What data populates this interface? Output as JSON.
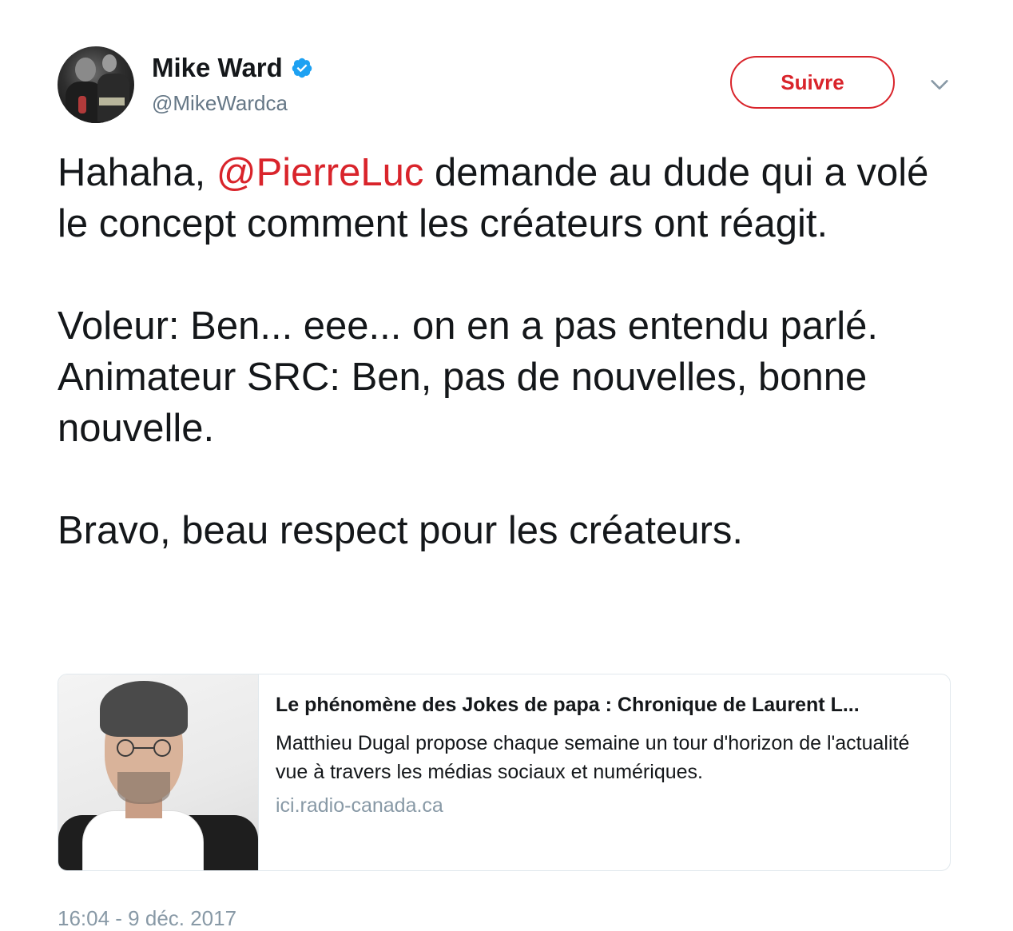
{
  "author": {
    "name": "Mike Ward",
    "handle": "@MikeWardca",
    "verified": true
  },
  "actions": {
    "follow_label": "Suivre",
    "more_icon": "chevron-down-icon"
  },
  "tweet": {
    "line1_pre": "Hahaha, ",
    "mention": "@PierreLuc",
    "line1_post": " demande au dude qui a volé le concept comment les créateurs ont réagit.",
    "para2": "Voleur: Ben... eee... on en a pas entendu parlé.",
    "para3": "Animateur SRC: Ben, pas de nouvelles, bonne nouvelle.",
    "para4": "Bravo, beau respect pour les créateurs."
  },
  "card": {
    "title": "Le phénomène des Jokes de papa : Chronique de Laurent L...",
    "description": "Matthieu Dugal propose chaque semaine un tour d'horizon de l'actualité vue à travers les médias sociaux et numériques.",
    "domain": "ici.radio-canada.ca"
  },
  "timestamp": "16:04 - 9 déc. 2017",
  "colors": {
    "accent": "#d9242b",
    "verified": "#1da1f2",
    "secondary_text": "#657786"
  }
}
